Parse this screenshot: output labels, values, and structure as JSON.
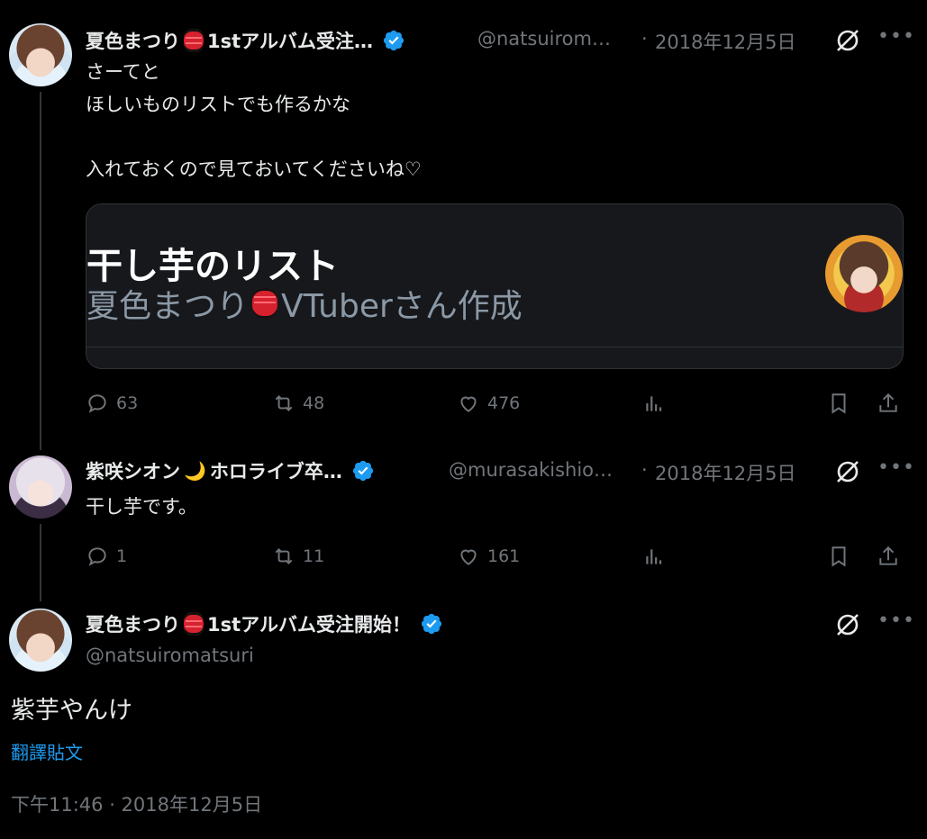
{
  "tweets": [
    {
      "name": "夏色まつり",
      "name_suffix": "1stアルバム受注…",
      "handle": "@natsuirom…",
      "separator": "·",
      "date": "2018年12月5日",
      "body": "さーてと\nほしいものリストでも作るかな\n\n入れておくので見ておいてくださいね♡",
      "card": {
        "title": "干し芋のリスト",
        "subtitle_name": "夏色まつり",
        "subtitle_suffix": "VTuberさん作成"
      },
      "actions": {
        "replies": "63",
        "reposts": "48",
        "likes": "476"
      }
    },
    {
      "name": "紫咲シオン",
      "name_suffix": "ホロライブ卒…",
      "handle": "@murasakishio…",
      "separator": "·",
      "date": "2018年12月5日",
      "body": "干し芋です。",
      "actions": {
        "replies": "1",
        "reposts": "11",
        "likes": "161"
      }
    }
  ],
  "main_tweet": {
    "name": "夏色まつり",
    "name_suffix": "1stアルバム受注開始！",
    "handle": "@natsuiromatsuri",
    "body": "紫芋やんけ",
    "translate_label": "翻譯貼文",
    "timestamp": "下午11:46 · 2018年12月5日"
  },
  "icons": {
    "more": "more-icon",
    "grok": "grok-icon",
    "reply": "reply-icon",
    "repost": "repost-icon",
    "like": "like-icon",
    "views": "views-icon",
    "bookmark": "bookmark-icon",
    "share": "share-icon",
    "verified": "verified-badge-icon",
    "lantern": "lantern-emoji-icon",
    "moon": "crescent-moon-emoji-icon"
  },
  "colors": {
    "background": "#000000",
    "text": "#e7e9ea",
    "muted": "#71767b",
    "accent": "#1d9bf0",
    "card_bg": "#16181c"
  }
}
